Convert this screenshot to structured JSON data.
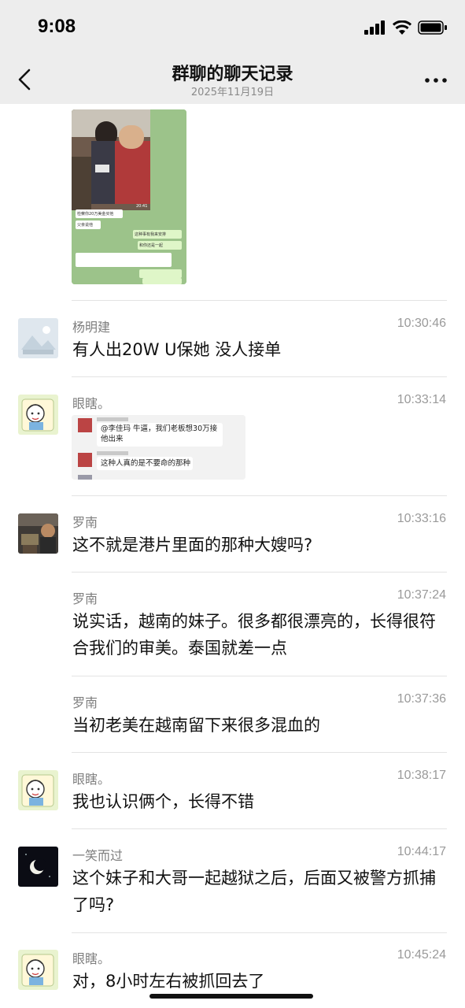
{
  "status_bar": {
    "time": "9:08",
    "icons": [
      "signal-icon",
      "wifi-icon",
      "battery-icon"
    ]
  },
  "header": {
    "title": "群聊的聊天记录",
    "date": "2025年11月19日"
  },
  "image_message": {
    "lines": [
      "检察你20万美金买他",
      "父亲说他",
      "这种事有我来安排",
      "和你还是一起"
    ],
    "photo_time": "20:41"
  },
  "messages": [
    {
      "sender": "杨明建",
      "time": "10:30:46",
      "text": "有人出20W U保她 没人接单"
    },
    {
      "sender": "眼瞎。",
      "time": "10:33:14",
      "quote": {
        "line1": "@李佳玛 牛逼，我们老板想30万接",
        "line1b": "他出来",
        "line2": "这种人真的是不要命的那种"
      }
    },
    {
      "sender": "罗南",
      "time": "10:33:16",
      "text": "这不就是港片里面的那种大嫂吗?"
    },
    {
      "sender": "罗南",
      "time": "10:37:24",
      "text": "说实话，越南的妹子。很多都很漂亮的，长得很符合我们的审美。泰国就差一点"
    },
    {
      "sender": "罗南",
      "time": "10:37:36",
      "text": "当初老美在越南留下来很多混血的"
    },
    {
      "sender": "眼瞎。",
      "time": "10:38:17",
      "text": "我也认识俩个，长得不错"
    },
    {
      "sender": "一笑而过",
      "time": "10:44:17",
      "text": "这个妹子和大哥一起越狱之后，后面又被警方抓捕了吗?"
    },
    {
      "sender": "眼瞎。",
      "time": "10:45:24",
      "text": "对，8小时左右被抓回去了"
    }
  ],
  "colors": {
    "background": "#ffffff",
    "bar": "#ededed",
    "name": "#7e7e7e",
    "time": "#9a9a9a"
  }
}
